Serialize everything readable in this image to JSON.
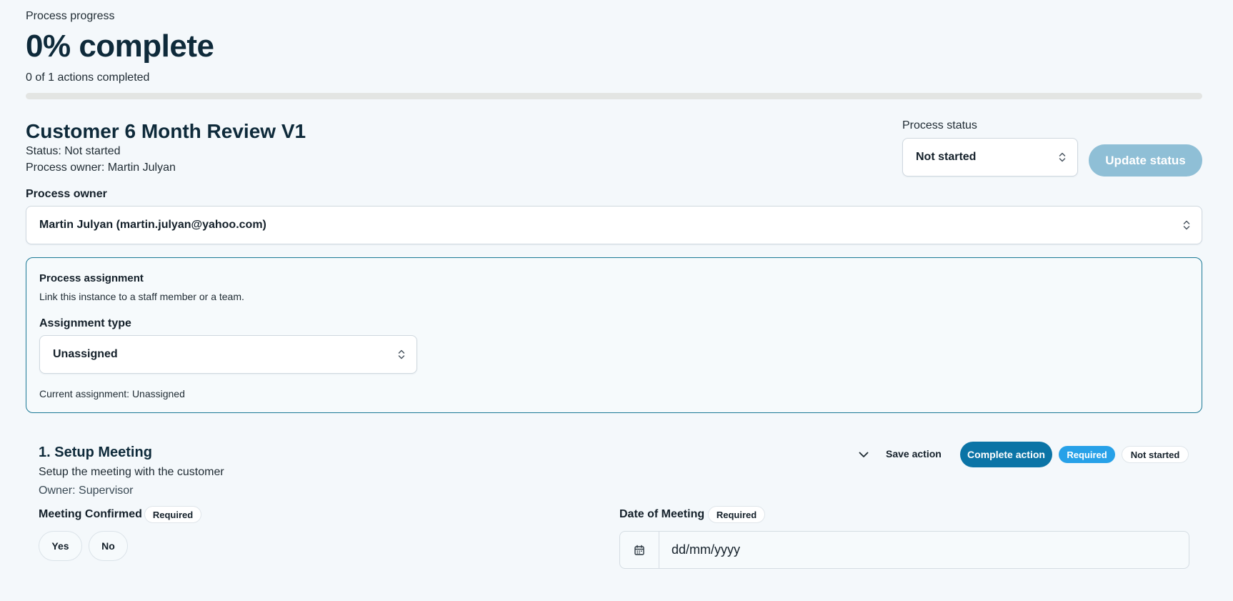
{
  "progress": {
    "eyebrow": "Process progress",
    "percent_label": "0% complete",
    "actions_label": "0 of 1 actions completed",
    "fraction": 0
  },
  "process": {
    "title": "Customer 6 Month Review V1",
    "status_line": "Status: Not started",
    "owner_line": "Process owner: Martin Julyan"
  },
  "status_control": {
    "label": "Process status",
    "selected": "Not started",
    "update_button": "Update status"
  },
  "owner_control": {
    "label": "Process owner",
    "selected": "Martin Julyan (martin.julyan@yahoo.com)"
  },
  "assignment": {
    "title": "Process assignment",
    "subtitle": "Link this instance to a staff member or a team.",
    "type_label": "Assignment type",
    "type_selected": "Unassigned",
    "current": "Current assignment: Unassigned"
  },
  "action": {
    "title": "1. Setup Meeting",
    "description": "Setup the meeting with the customer",
    "owner": "Owner: Supervisor",
    "save_label": "Save action",
    "complete_label": "Complete action",
    "required_badge": "Required",
    "status_badge": "Not started",
    "fields": {
      "meeting": {
        "label": "Meeting Confirmed",
        "required": "Required",
        "yes": "Yes",
        "no": "No"
      },
      "date": {
        "label": "Date of Meeting",
        "required": "Required",
        "placeholder": "dd/mm/yyyy"
      }
    }
  },
  "colors": {
    "accent": "#0b74a6",
    "required_blue": "#27a1e8",
    "disabled_button": "#8fbfd6",
    "page_bg": "#f4f8fb"
  },
  "icons": {
    "select": "chevron-up-down-icon",
    "collapse": "chevron-down-icon",
    "date": "calendar-icon"
  }
}
